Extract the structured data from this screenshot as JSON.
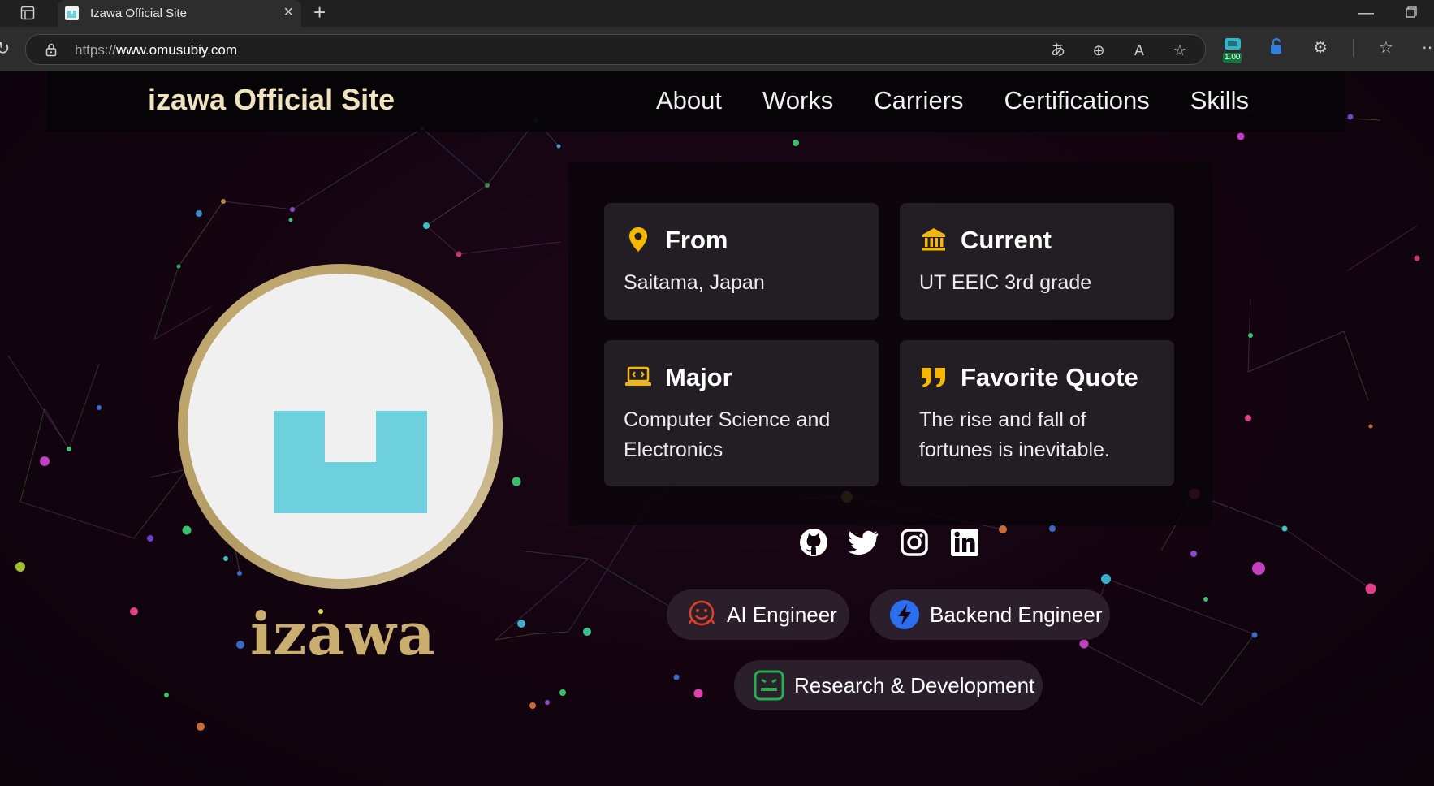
{
  "browser": {
    "tab_title": "Izawa Official Site",
    "url_scheme": "https://",
    "url_host": "www.omusubiy.com",
    "extension_badge": "1.00",
    "icons": [
      "sidebar-icon",
      "close-icon",
      "plus-icon",
      "minimize-icon",
      "restore-icon",
      "reload-icon",
      "lock-icon",
      "read-aloud-icon",
      "zoom-icon",
      "immersive-reader-icon",
      "favorite-star-icon",
      "extension-icon",
      "favorites-icon",
      "more-icon"
    ]
  },
  "nav": {
    "brand_first": "izawa",
    "brand_rest": " Official Site",
    "links": [
      "About",
      "Works",
      "Carriers",
      "Certifications",
      "Skills"
    ]
  },
  "profile": {
    "name": "izawa"
  },
  "cards": [
    {
      "title": "From",
      "text": "Saitama, Japan",
      "icon": "map-pin-icon"
    },
    {
      "title": "Current",
      "text": "UT EEIC 3rd grade",
      "icon": "institution-icon"
    },
    {
      "title": "Major",
      "text": "Computer Science and Electronics",
      "icon": "laptop-code-icon"
    },
    {
      "title": "Favorite Quote",
      "text": "The rise and fall of fortunes is inevitable.",
      "icon": "quote-icon"
    }
  ],
  "socials": [
    "github-icon",
    "twitter-icon",
    "instagram-icon",
    "linkedin-icon"
  ],
  "roles": [
    {
      "label": "AI Engineer",
      "icon": "huggingface-icon"
    },
    {
      "label": "Backend Engineer",
      "icon": "fastapi-icon"
    },
    {
      "label": "Research & Development",
      "icon": "robot-icon"
    }
  ],
  "colors": {
    "accent_gold": "#c9ae70",
    "icon_yellow": "#f5b800",
    "logo_cyan": "#6ed0dd",
    "background": "#12040f"
  }
}
